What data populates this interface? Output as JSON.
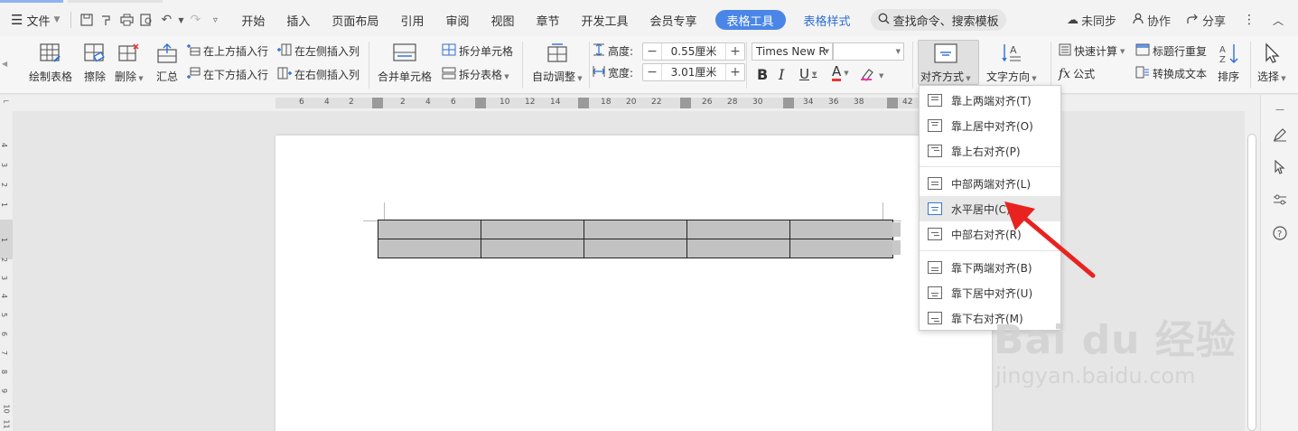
{
  "menubar": {
    "file_label": "文件",
    "tabs": [
      "开始",
      "插入",
      "页面布局",
      "引用",
      "审阅",
      "视图",
      "章节",
      "开发工具",
      "会员专享"
    ],
    "active_tab": "表格工具",
    "style_tab": "表格样式",
    "search_placeholder": "查找命令、搜索模板",
    "sync_label": "未同步",
    "collab_label": "协作",
    "share_label": "分享"
  },
  "ribbon": {
    "draw_table": "绘制表格",
    "erase": "擦除",
    "delete": "删除",
    "summary": "汇总",
    "insert_row_above": "在上方插入行",
    "insert_row_below": "在下方插入行",
    "insert_col_left": "在左侧插入列",
    "insert_col_right": "在右侧插入列",
    "merge_cells": "合并单元格",
    "split_cells": "拆分单元格",
    "split_table": "拆分表格",
    "auto_fit": "自动调整",
    "height_label": "高度:",
    "height_value": "0.55厘米",
    "width_label": "宽度:",
    "width_value": "3.01厘米",
    "font_name": "Times New R",
    "bold": "B",
    "italic": "I",
    "underline": "U",
    "font_color": "A",
    "align": "对齐方式",
    "text_direction": "文字方向",
    "quick_calc": "快速计算",
    "formula": "公式",
    "repeat_header": "标题行重复",
    "to_text": "转换成文本",
    "sort": "排序",
    "select": "选择"
  },
  "ruler": {
    "left_ticks": [
      "6",
      "4",
      "2"
    ],
    "ticks": [
      "2",
      "4",
      "6",
      "10",
      "12",
      "14",
      "18",
      "20",
      "22",
      "26",
      "28",
      "30",
      "34",
      "36",
      "38",
      "42"
    ],
    "vertical_ticks": [
      "4",
      "3",
      "2",
      "1",
      "1",
      "2",
      "3",
      "4",
      "5",
      "6",
      "7",
      "8",
      "9",
      "10",
      "11"
    ]
  },
  "dropdown": {
    "items": [
      "靠上两端对齐(T)",
      "靠上居中对齐(O)",
      "靠上右对齐(P)",
      "中部两端对齐(L)",
      "水平居中(C)",
      "中部右对齐(R)",
      "靠下两端对齐(B)",
      "靠下居中对齐(U)",
      "靠下右对齐(M)"
    ],
    "highlighted": "水平居中(C)"
  },
  "watermark": {
    "brand": "Bai du 经验",
    "url": "jingyan.baidu.com"
  },
  "colors": {
    "accent": "#4a86e8",
    "arrow": "#e8231f",
    "table_fill": "#c2c2c2"
  }
}
